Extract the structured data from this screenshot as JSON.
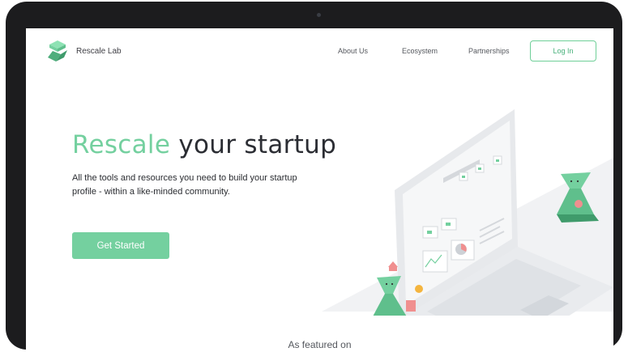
{
  "brand": {
    "name": "Rescale Lab",
    "logo_icon": "stacked-cubes-logo"
  },
  "nav": {
    "links": [
      "About Us",
      "Ecosystem",
      "Partnerships"
    ],
    "login_label": "Log In"
  },
  "hero": {
    "headline_accent": "Rescale",
    "headline_rest": " your startup",
    "subtitle": "All the tools and resources you need to build your startup profile - within a like-minded community.",
    "cta_label": "Get Started"
  },
  "featured": {
    "label": "As featured on"
  },
  "colors": {
    "accent": "#74d09f",
    "accent_dark": "#46b07a",
    "device_frame": "#1c1c1e",
    "text_dark": "#2b2d33"
  }
}
